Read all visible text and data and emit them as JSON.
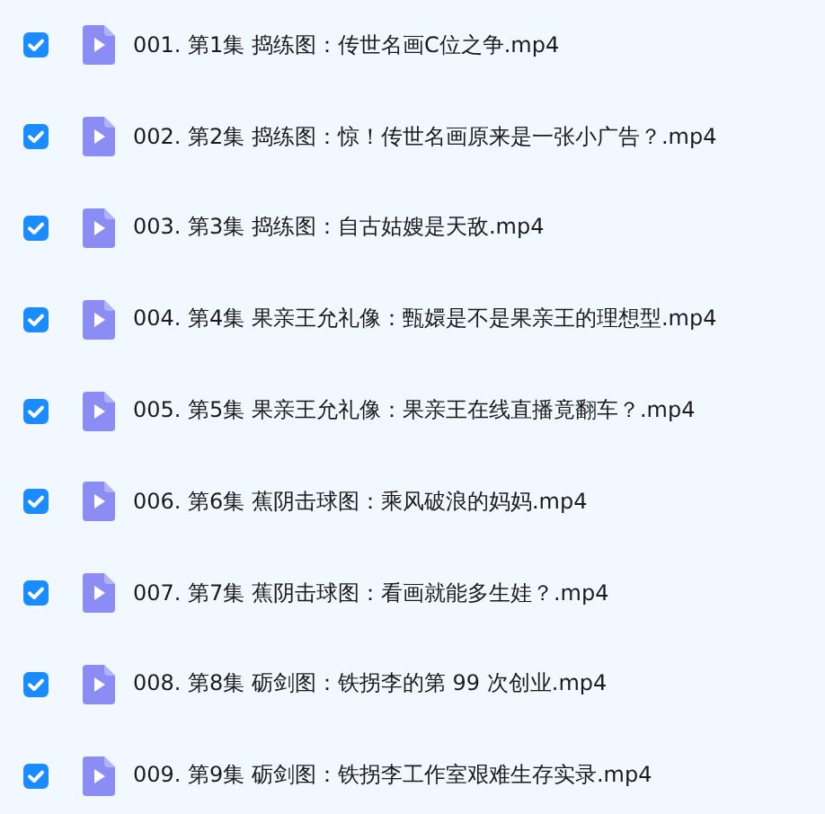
{
  "files": [
    {
      "name": "001. 第1集 捣练图：传世名画C位之争.mp4",
      "checked": true
    },
    {
      "name": "002. 第2集 捣练图：惊！传世名画原来是一张小广告？.mp4",
      "checked": true
    },
    {
      "name": "003. 第3集 捣练图：自古姑嫂是天敌.mp4",
      "checked": true
    },
    {
      "name": "004. 第4集 果亲王允礼像：甄嬛是不是果亲王的理想型.mp4",
      "checked": true
    },
    {
      "name": "005. 第5集 果亲王允礼像：果亲王在线直播竟翻车？.mp4",
      "checked": true
    },
    {
      "name": "006. 第6集 蕉阴击球图：乘风破浪的妈妈.mp4",
      "checked": true
    },
    {
      "name": "007. 第7集 蕉阴击球图：看画就能多生娃？.mp4",
      "checked": true
    },
    {
      "name": "008. 第8集 砺剑图：铁拐李的第 99 次创业.mp4",
      "checked": true
    },
    {
      "name": "009. 第9集 砺剑图：铁拐李工作室艰难生存实录.mp4",
      "checked": true
    }
  ]
}
